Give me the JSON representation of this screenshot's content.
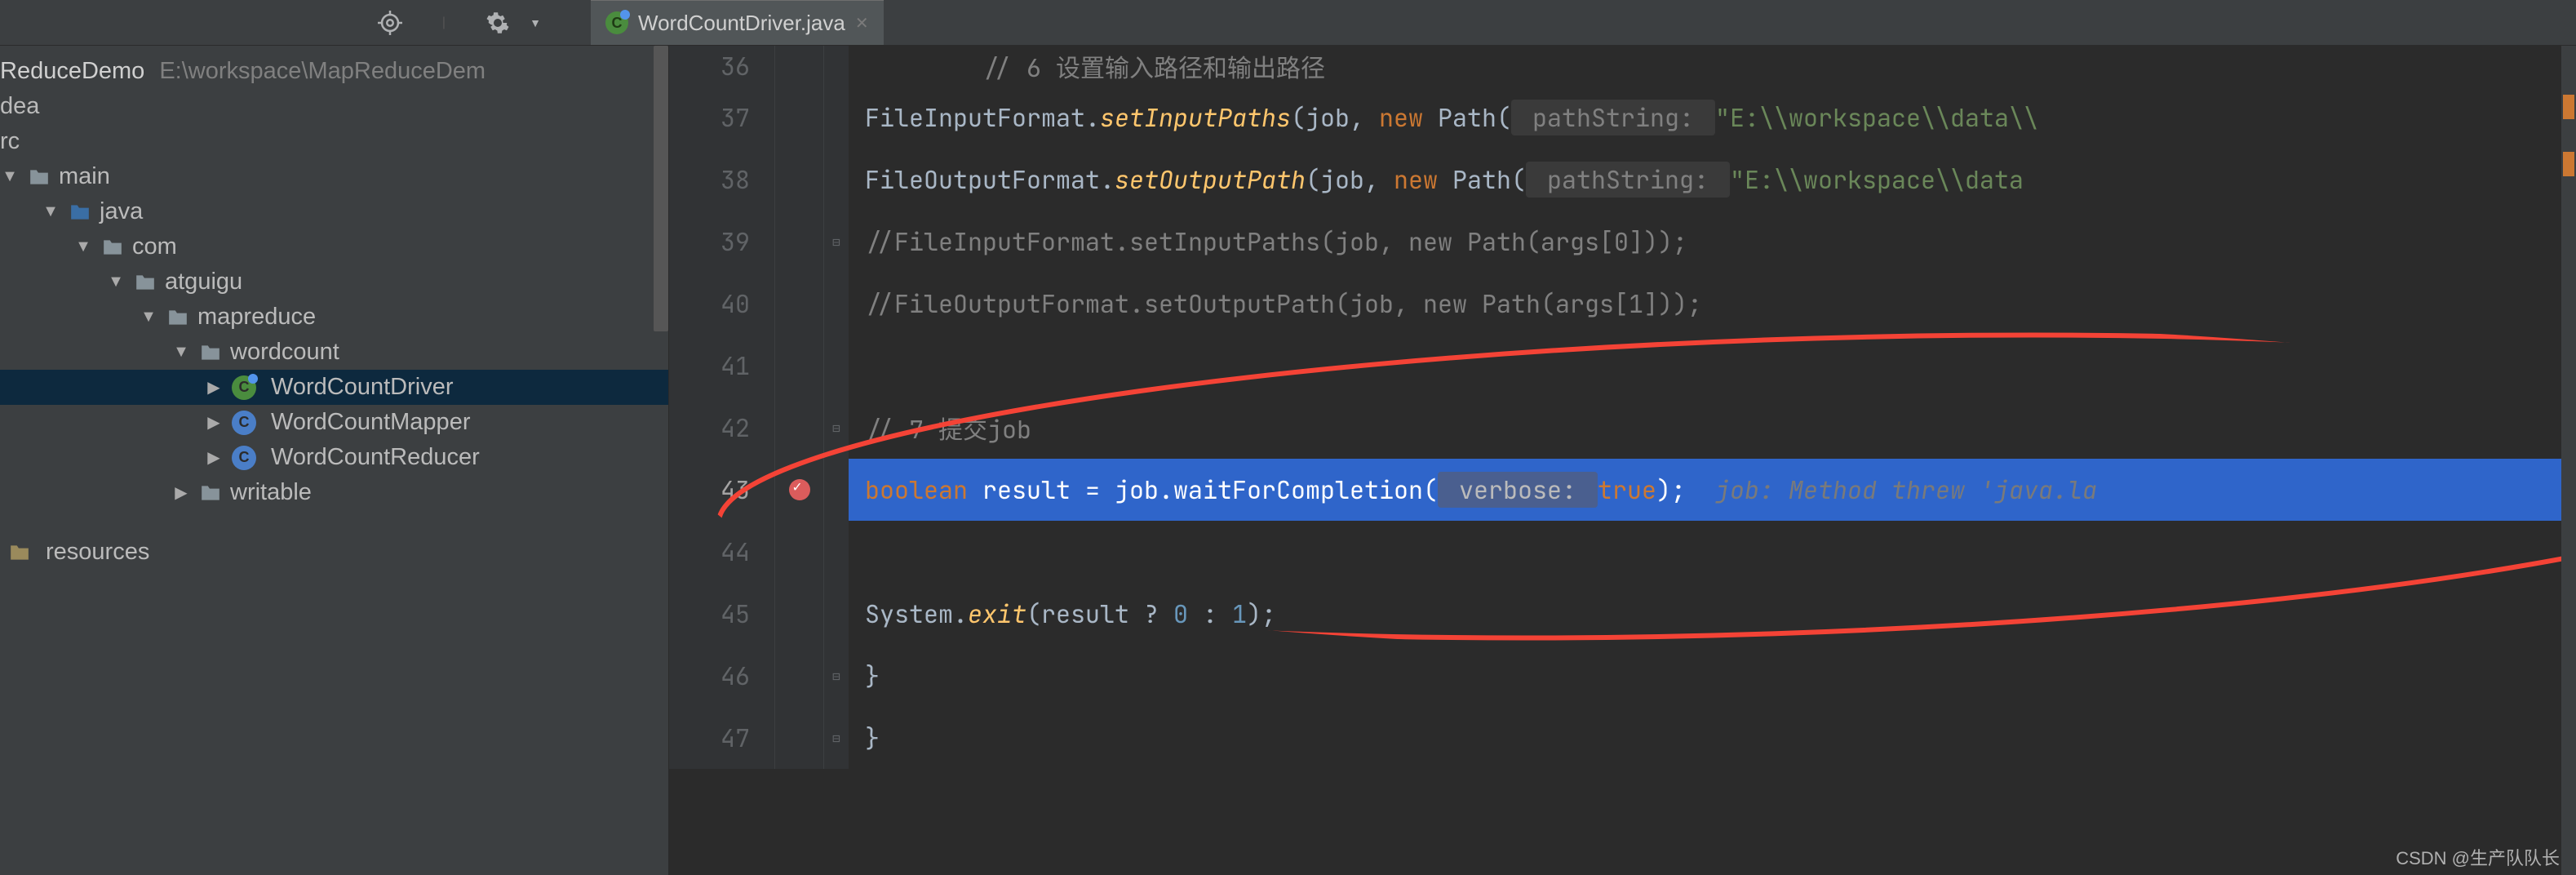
{
  "tab": {
    "filename": "WordCountDriver.java"
  },
  "project": {
    "name": "ReduceDemo",
    "path": "E:\\workspace\\MapReduceDem",
    "tree": {
      "dea": "dea",
      "rc": "rc",
      "main": "main",
      "java": "java",
      "com": "com",
      "atguigu": "atguigu",
      "mapreduce": "mapreduce",
      "wordcount": "wordcount",
      "wcd": "WordCountDriver",
      "wcm": "WordCountMapper",
      "wcr": "WordCountReducer",
      "writable": "writable",
      "resources": "resources"
    }
  },
  "code": {
    "line36": "// 6 设置输入路径和输出路径",
    "line36_no": "36",
    "line37_no": "37",
    "line37_a": "FileInputFormat.",
    "line37_b": "setInputPaths",
    "line37_c": "(job, ",
    "line37_d": "new",
    "line37_e": " Path(",
    "line37_f": " pathString: ",
    "line37_g": "\"E:\\\\workspace\\\\data\\\\",
    "line38_no": "38",
    "line38_a": "FileOutputFormat.",
    "line38_b": "setOutputPath",
    "line38_c": "(job, ",
    "line38_d": "new",
    "line38_e": " Path(",
    "line38_f": " pathString: ",
    "line38_g": "\"E:\\\\workspace\\\\data",
    "line39_no": "39",
    "line39_a": "//",
    "line39_b": "FileInputFormat.setInputPaths(job, new Path(args[0]));",
    "line40_no": "40",
    "line40_a": "//",
    "line40_b": "FileOutputFormat.setOutputPath(job, new Path(args[1]));",
    "line41_no": "41",
    "line42_no": "42",
    "line42": "// 7 提交job",
    "line43_no": "43",
    "line43_a": "boolean",
    "line43_b": " result = job.waitForCompletion(",
    "line43_c": " verbose: ",
    "line43_d": "true",
    "line43_e": ");  ",
    "line43_f": "job: Method threw 'java.la",
    "line44_no": "44",
    "line45_no": "45",
    "line45_a": "System.",
    "line45_b": "exit",
    "line45_c": "(result ? ",
    "line45_d": "0",
    "line45_e": " : ",
    "line45_f": "1",
    "line45_g": ");",
    "line46_no": "46",
    "line46": "}",
    "line47_no": "47",
    "line47": "}"
  },
  "watermark": "CSDN @生产队队长"
}
